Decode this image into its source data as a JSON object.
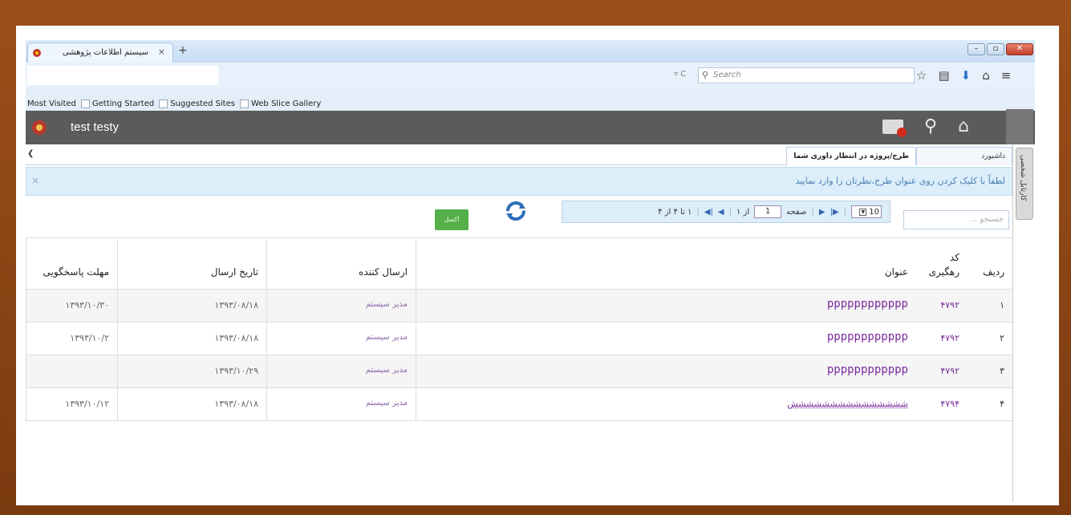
{
  "browser": {
    "tab_title": "سیستم اطلاعات پژوهشی",
    "tab_close": "×",
    "new_tab": "+",
    "reload": "▿ C",
    "search_placeholder": "Search",
    "bookmarks": [
      "Most Visited",
      "Getting Started",
      "Suggested Sites",
      "Web Slice Gallery"
    ]
  },
  "app": {
    "user": "test testy",
    "icons": [
      "mail-icon",
      "search-icon",
      "home-icon"
    ]
  },
  "tabs": [
    {
      "label": "داشبورد"
    },
    {
      "label": "طرح/پروژه در انتظار داوری شما"
    }
  ],
  "side_tab": "کارتابل شخصی",
  "info": {
    "message": "لطفاً با کلیک کردن روی عنوان طرح،نظرتان را وارد نمایید",
    "close": "×"
  },
  "toolbar": {
    "excel_label": "اکسل",
    "page_size": "10",
    "page_label": "صفحه",
    "page_value": "1",
    "of_label": "از ۱",
    "summary": "۱ تا ۴ از ۴",
    "search_placeholder": "جستجو ..."
  },
  "grid": {
    "columns": {
      "row": "ردیف",
      "code_line1": "کد",
      "code_line2": "رهگیری",
      "title": "عنوان",
      "sender": "ارسال کننده",
      "sent_date": "تاریخ ارسال",
      "due": "مهلت پاسخگویی"
    },
    "rows": [
      {
        "row": "۱",
        "code": "۴۷۹۲",
        "title": "pppppppppppp",
        "sender": "مدیر سیستم",
        "sent_date": "۱۳۹۳/۰۸/۱۸",
        "due": "۱۳۹۳/۱۰/۳۰"
      },
      {
        "row": "۲",
        "code": "۴۷۹۲",
        "title": "pppppppppppp",
        "sender": "مدیر سیستم",
        "sent_date": "۱۳۹۳/۰۸/۱۸",
        "due": "۱۳۹۳/۱۰/۲"
      },
      {
        "row": "۳",
        "code": "۴۷۹۲",
        "title": "pppppppppppp",
        "sender": "مدیر سیستم",
        "sent_date": "۱۳۹۳/۱۰/۲۹",
        "due": ""
      },
      {
        "row": "۴",
        "code": "۴۷۹۴",
        "title": "ششششششششششششششش",
        "sender": "مدیر سیستم",
        "sent_date": "۱۳۹۳/۰۸/۱۸",
        "due": "۱۳۹۳/۱۰/۱۲"
      }
    ]
  }
}
